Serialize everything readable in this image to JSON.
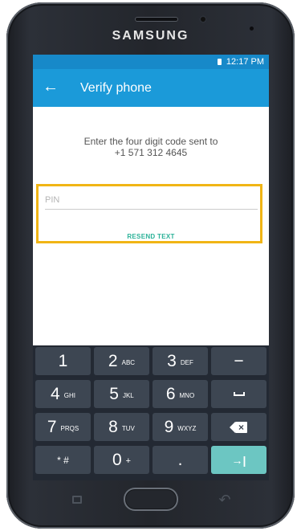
{
  "device": {
    "brand": "SAMSUNG"
  },
  "status_bar": {
    "time": "12:17 PM",
    "color": "#1789c9"
  },
  "app_bar": {
    "back_icon": "arrow-left-icon",
    "title": "Verify phone",
    "color": "#1b9ad9"
  },
  "content": {
    "instruction_line1": "Enter the four digit code sent to",
    "instruction_line2": "+1 571 312 4645",
    "pin_placeholder": "PIN",
    "pin_value": "",
    "resend_label": "RESEND TEXT",
    "resend_color": "#2bb298",
    "highlight_color": "#f1b515"
  },
  "keypad": {
    "rows": [
      [
        {
          "main": "1",
          "sub": ""
        },
        {
          "main": "2",
          "sub": "ABC"
        },
        {
          "main": "3",
          "sub": "DEF"
        },
        {
          "main": "−",
          "sub": ""
        }
      ],
      [
        {
          "main": "4",
          "sub": "GHI"
        },
        {
          "main": "5",
          "sub": "JKL"
        },
        {
          "main": "6",
          "sub": "MNO"
        },
        {
          "main": "",
          "sub": "",
          "icon": "space-icon"
        }
      ],
      [
        {
          "main": "7",
          "sub": "PRQS"
        },
        {
          "main": "8",
          "sub": "TUV"
        },
        {
          "main": "9",
          "sub": "WXYZ"
        },
        {
          "main": "",
          "sub": "",
          "icon": "backspace-icon"
        }
      ],
      [
        {
          "main": "* #",
          "sub": ""
        },
        {
          "main": "0",
          "sub": "+"
        },
        {
          "main": ".",
          "sub": ""
        },
        {
          "main": "→|",
          "sub": "",
          "icon": "tab-next-icon"
        }
      ]
    ],
    "background": "#232933",
    "key_color": "#3d4652",
    "action_key_color": "#6cc6c2"
  },
  "hardware_buttons": {
    "recent_icon": "recent-apps-icon",
    "home_icon": "home-button",
    "back_icon": "back-icon"
  }
}
